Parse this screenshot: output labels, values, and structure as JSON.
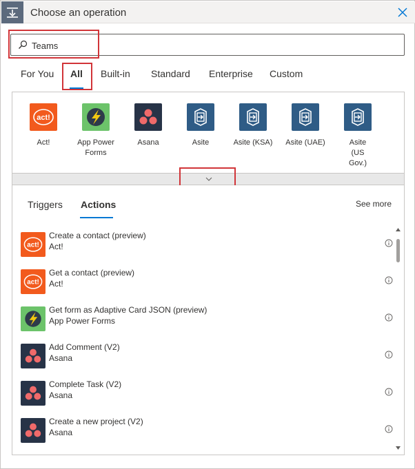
{
  "header": {
    "title": "Choose an operation"
  },
  "search": {
    "value": "Teams"
  },
  "category_tabs": [
    {
      "label": "For You"
    },
    {
      "label": "All",
      "active": true
    },
    {
      "label": "Built-in"
    },
    {
      "label": "Standard"
    },
    {
      "label": "Enterprise"
    },
    {
      "label": "Custom"
    }
  ],
  "connectors": [
    {
      "label": "Act!",
      "icon": "act-logo-icon",
      "color": "#f25a1d"
    },
    {
      "label": "App Power Forms",
      "icon": "app-power-forms-icon",
      "color": "#6cc36a"
    },
    {
      "label": "Asana",
      "icon": "asana-icon",
      "color": "#273347"
    },
    {
      "label": "Asite",
      "icon": "asite-icon",
      "color": "#2f5c86"
    },
    {
      "label": "Asite (KSA)",
      "icon": "asite-icon",
      "color": "#2f5c86"
    },
    {
      "label": "Asite (UAE)",
      "icon": "asite-icon",
      "color": "#2f5c86"
    },
    {
      "label": "Asite (US Gov.)",
      "icon": "asite-icon",
      "color": "#2f5c86"
    }
  ],
  "sub_tabs": [
    {
      "label": "Triggers"
    },
    {
      "label": "Actions",
      "active": true
    }
  ],
  "see_more": "See more",
  "actions": [
    {
      "title": "Create a contact (preview)",
      "connector": "Act!",
      "icon": "act-logo-icon"
    },
    {
      "title": "Get a contact (preview)",
      "connector": "Act!",
      "icon": "act-logo-icon"
    },
    {
      "title": "Get form as Adaptive Card JSON (preview)",
      "connector": "App Power Forms",
      "icon": "app-power-forms-icon"
    },
    {
      "title": "Add Comment (V2)",
      "connector": "Asana",
      "icon": "asana-icon"
    },
    {
      "title": "Complete Task (V2)",
      "connector": "Asana",
      "icon": "asana-icon"
    },
    {
      "title": "Create a new project (V2)",
      "connector": "Asana",
      "icon": "asana-icon"
    }
  ],
  "colors": {
    "accent": "#0078d4",
    "highlight": "#d13438",
    "act": "#f25a1d",
    "app_power_forms": "#6cc36a",
    "asana_bg": "#273347",
    "asana_dots": "#f06a6a",
    "asite": "#2f5c86"
  }
}
